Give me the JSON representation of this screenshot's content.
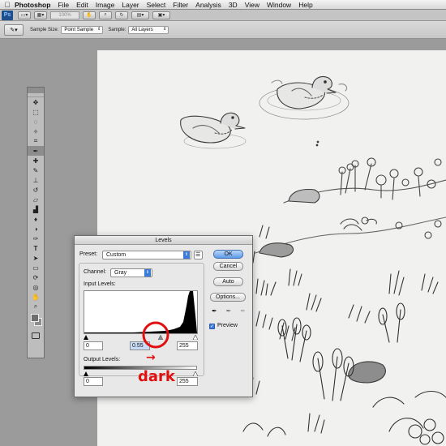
{
  "menubar": {
    "apple": "",
    "app_name": "Photoshop",
    "items": [
      "File",
      "Edit",
      "Image",
      "Layer",
      "Select",
      "Filter",
      "Analysis",
      "3D",
      "View",
      "Window",
      "Help"
    ]
  },
  "appbar": {
    "logo": "Ps",
    "zoom": "100%"
  },
  "options": {
    "sample_size_label": "Sample Size:",
    "sample_size_value": "Point Sample",
    "sample_label": "Sample:",
    "sample_value": "All Layers"
  },
  "levels": {
    "title": "Levels",
    "preset_label": "Preset:",
    "preset_value": "Custom",
    "channel_label": "Channel:",
    "channel_value": "Gray",
    "input_label": "Input Levels:",
    "input_black": "0",
    "input_gamma": "0.55",
    "input_white": "255",
    "output_label": "Output Levels:",
    "output_black": "0",
    "output_white": "255",
    "ok": "OK",
    "cancel": "Cancel",
    "auto": "Auto",
    "options": "Options...",
    "preview_label": "Preview",
    "preview_checked": true
  },
  "annotation": {
    "text": "dark",
    "arrow": "→",
    "color": "#e01010"
  },
  "icons": {
    "eyedropper": "eyedropper-icon",
    "black_point": "black-eyedropper-icon",
    "gray_point": "gray-eyedropper-icon",
    "white_point": "white-eyedropper-icon"
  }
}
